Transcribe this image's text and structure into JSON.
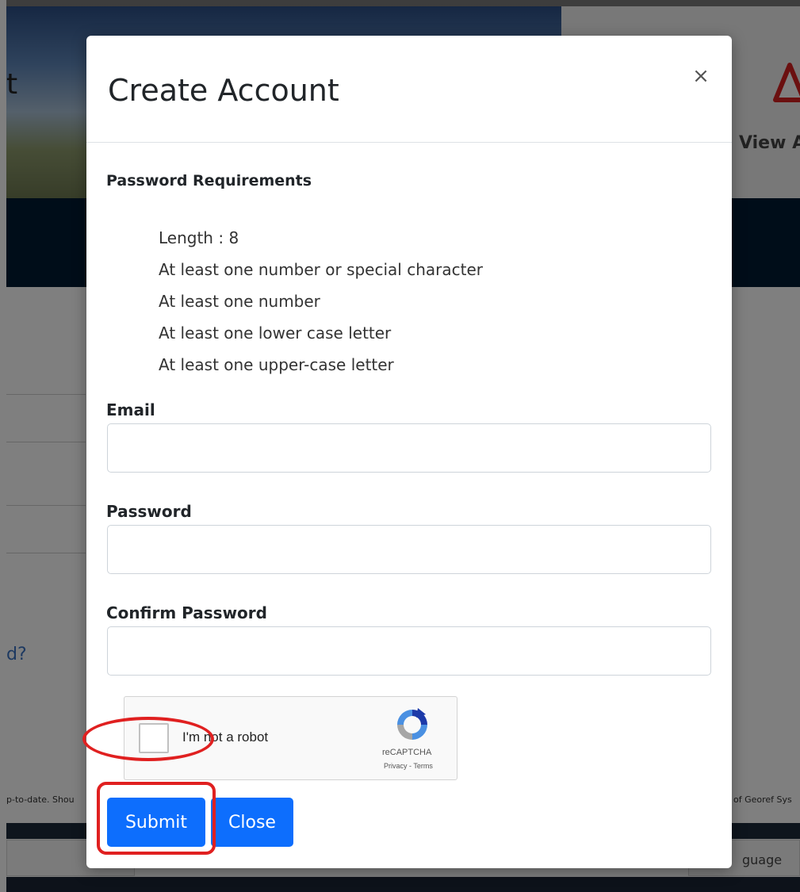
{
  "background": {
    "heading_fragment": "t",
    "view_fragment": "View A",
    "forgot_fragment": "d?",
    "footer_left_fragment": "p-to-date. Shou",
    "footer_right_fragment": "of Georef Sys",
    "language_fragment": "guage",
    "alert_icon": "warning-triangle-icon",
    "colors": {
      "navbar": "#001a33",
      "link": "#3a72c2"
    }
  },
  "modal": {
    "title": "Create Account",
    "close_symbol": "×",
    "requirements": {
      "title": "Password Requirements",
      "items": [
        "Length : 8",
        "At least one number or special character",
        "At least one number",
        "At least one lower case letter",
        "At least one upper-case letter"
      ]
    },
    "form": {
      "email_label": "Email",
      "email_value": "",
      "password_label": "Password",
      "password_value": "",
      "confirm_label": "Confirm Password",
      "confirm_value": ""
    },
    "recaptcha": {
      "label": "I'm not a robot",
      "brand": "reCAPTCHA",
      "privacy": "Privacy",
      "separator": " - ",
      "terms": "Terms",
      "logo_icon": "recaptcha-logo-icon"
    },
    "buttons": {
      "submit": "Submit",
      "close": "Close"
    },
    "colors": {
      "primary": "#0d6efd",
      "annotation": "#e02020"
    }
  }
}
